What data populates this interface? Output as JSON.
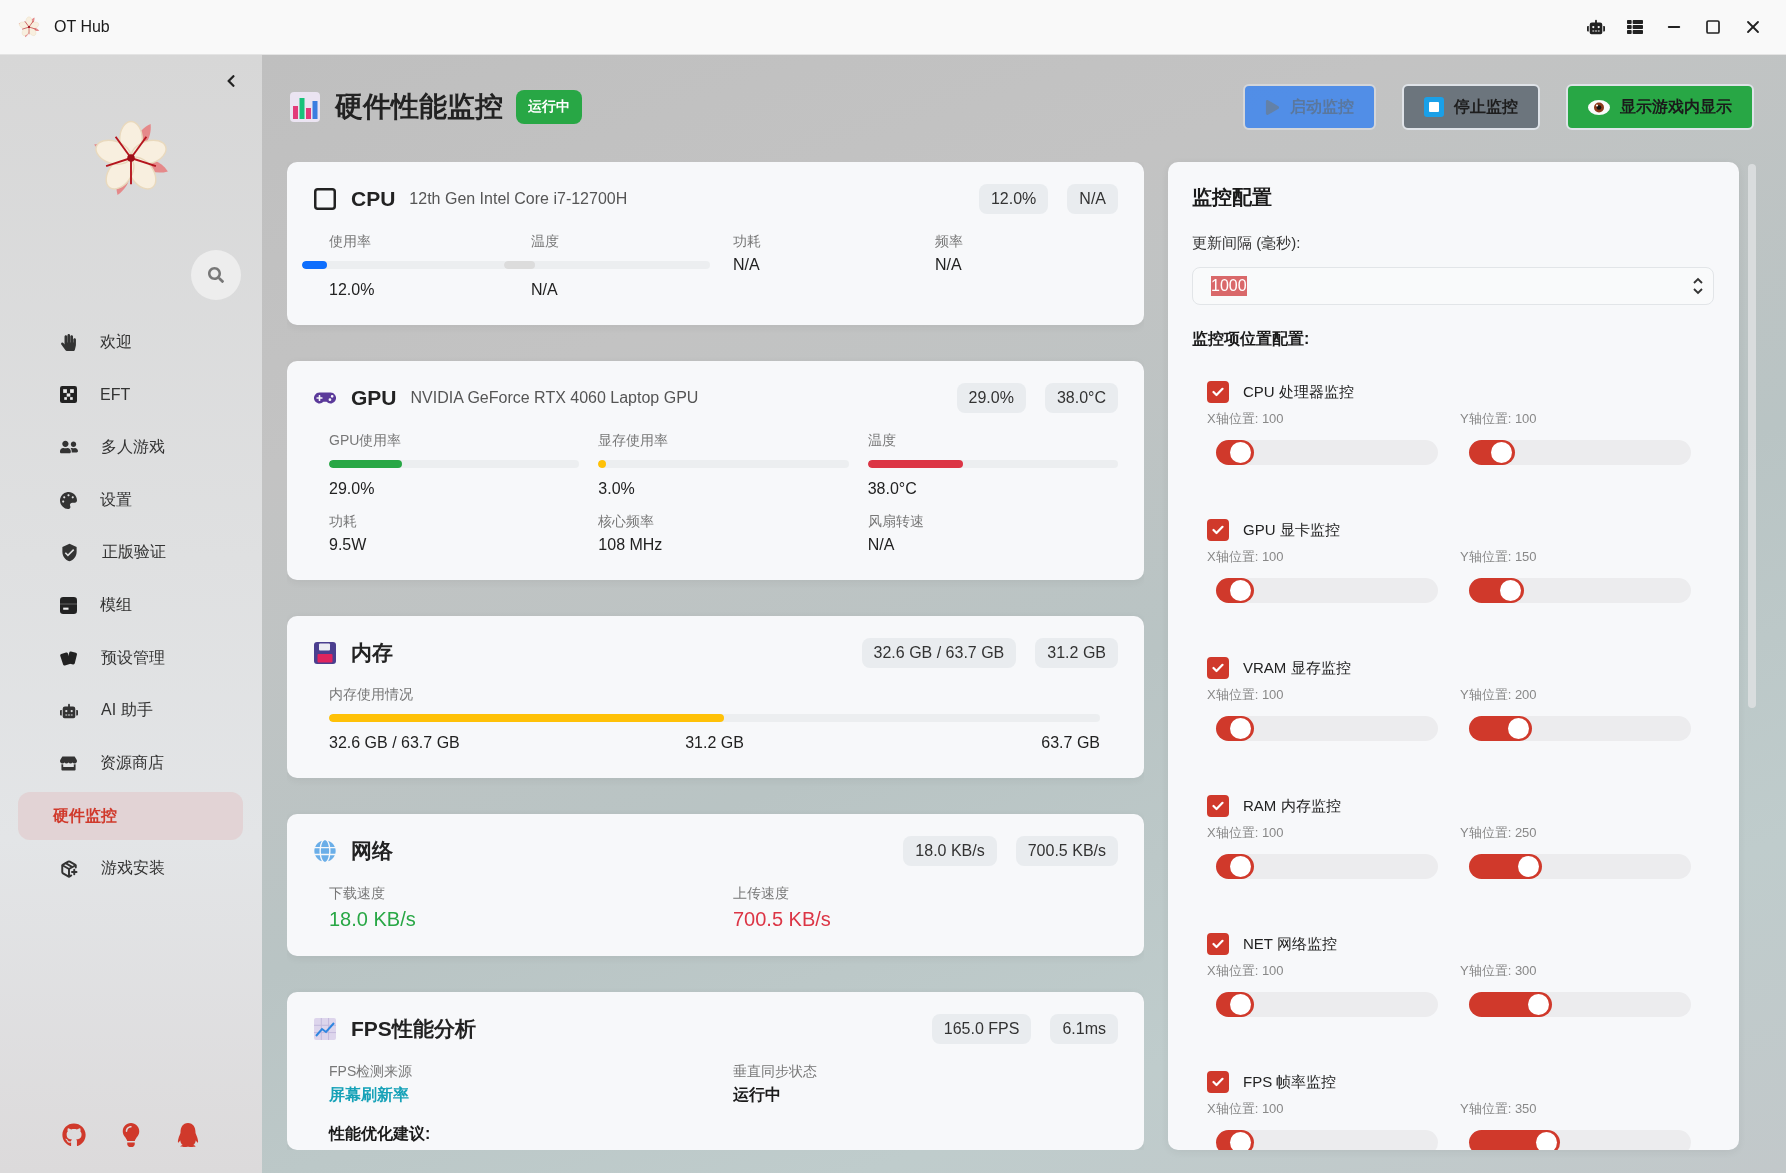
{
  "window": {
    "title": "OT Hub"
  },
  "sidebar": {
    "items": [
      {
        "label": "欢迎",
        "selected": false
      },
      {
        "label": "EFT",
        "selected": false
      },
      {
        "label": "多人游戏",
        "selected": false
      },
      {
        "label": "设置",
        "selected": false
      },
      {
        "label": "正版验证",
        "selected": false
      },
      {
        "label": "模组",
        "selected": false
      },
      {
        "label": "预设管理",
        "selected": false
      },
      {
        "label": "AI 助手",
        "selected": false
      },
      {
        "label": "资源商店",
        "selected": false
      },
      {
        "label": "硬件监控",
        "selected": true
      },
      {
        "label": "游戏安装",
        "selected": false
      }
    ]
  },
  "header": {
    "title": "硬件性能监控",
    "badge": "运行中"
  },
  "actions": [
    {
      "kind": "start",
      "label": "启动监控",
      "disabled": true
    },
    {
      "kind": "stop",
      "label": "停止监控",
      "disabled": false
    },
    {
      "kind": "overlay",
      "label": "显示游戏内显示",
      "disabled": false
    }
  ],
  "cards": [
    {
      "kind": "cpu",
      "title": "CPU",
      "subtitle": "12th Gen Intel Core i7-12700H",
      "pills": [
        "12.0%",
        "N/A"
      ],
      "metrics": [
        {
          "label": "使用率",
          "value": "12.0%",
          "level": 0.12,
          "color": "#0d6efd"
        },
        {
          "label": "温度",
          "value": "N/A",
          "level": 0.15,
          "color": "#dcdcdc"
        },
        {
          "label": "功耗",
          "value": "N/A"
        },
        {
          "label": "频率",
          "value": "N/A"
        }
      ]
    },
    {
      "kind": "gpu",
      "title": "GPU",
      "subtitle": "NVIDIA GeForce RTX 4060 Laptop GPU",
      "pills": [
        "29.0%",
        "38.0°C"
      ],
      "metrics": [
        {
          "label": "GPU使用率",
          "value": "29.0%",
          "level": 0.29,
          "color": "#28a745"
        },
        {
          "label": "显存使用率",
          "value": "3.0%",
          "level": 0.03,
          "color": "#ffc107"
        },
        {
          "label": "温度",
          "value": "38.0°C",
          "level": 0.38,
          "color": "#dc3545"
        },
        {
          "label": "功耗",
          "value": "9.5W"
        },
        {
          "label": "核心频率",
          "value": "108 MHz"
        },
        {
          "label": "风扇转速",
          "value": "N/A"
        }
      ]
    },
    {
      "kind": "memory",
      "title": "内存",
      "pills": [
        "32.6 GB / 63.7 GB",
        "31.2 GB"
      ],
      "usage": {
        "label": "内存使用情况",
        "level": 0.512,
        "color": "#ffc107",
        "readings": [
          "32.6 GB / 63.7 GB",
          "31.2 GB",
          "63.7 GB"
        ]
      }
    },
    {
      "kind": "network",
      "title": "网络",
      "pills": [
        "18.0 KB/s",
        "700.5 KB/s"
      ],
      "metrics": [
        {
          "label": "下载速度",
          "value": "18.0 KB/s",
          "color": "#28a745"
        },
        {
          "label": "上传速度",
          "value": "700.5 KB/s",
          "color": "#dc3545"
        }
      ]
    },
    {
      "kind": "fps",
      "title": "FPS性能分析",
      "pills": [
        "165.0 FPS",
        "6.1ms"
      ],
      "metrics": [
        {
          "label": "FPS检测来源",
          "value": "屏幕刷新率",
          "color": "#17a2b8"
        },
        {
          "label": "垂直同步状态",
          "value": "运行中",
          "color": "#1a1a1a"
        }
      ],
      "note": "性能优化建议:"
    }
  ],
  "config": {
    "title": "监控配置",
    "interval_label": "更新间隔 (毫秒):",
    "interval_value": "1000",
    "interval_highlighted": true,
    "positions_title": "监控项位置配置:",
    "items": [
      {
        "label": "CPU 处理器监控",
        "checked": true,
        "sliders": [
          {
            "label": "X轴位置: 100",
            "level": 0.17
          },
          {
            "label": "Y轴位置: 100",
            "level": 0.205
          }
        ]
      },
      {
        "label": "GPU 显卡监控",
        "checked": true,
        "sliders": [
          {
            "label": "X轴位置: 100",
            "level": 0.17
          },
          {
            "label": "Y轴位置: 150",
            "level": 0.247
          }
        ]
      },
      {
        "label": "VRAM 显存监控",
        "checked": true,
        "sliders": [
          {
            "label": "X轴位置: 100",
            "level": 0.17
          },
          {
            "label": "Y轴位置: 200",
            "level": 0.286
          }
        ]
      },
      {
        "label": "RAM 内存监控",
        "checked": true,
        "sliders": [
          {
            "label": "X轴位置: 100",
            "level": 0.17
          },
          {
            "label": "Y轴位置: 250",
            "level": 0.328
          }
        ]
      },
      {
        "label": "NET 网络监控",
        "checked": true,
        "sliders": [
          {
            "label": "X轴位置: 100",
            "level": 0.17
          },
          {
            "label": "Y轴位置: 300",
            "level": 0.373
          }
        ]
      },
      {
        "label": "FPS 帧率监控",
        "checked": true,
        "sliders": [
          {
            "label": "X轴位置: 100",
            "level": 0.17
          },
          {
            "label": "Y轴位置: 350",
            "level": 0.41
          }
        ]
      }
    ]
  }
}
